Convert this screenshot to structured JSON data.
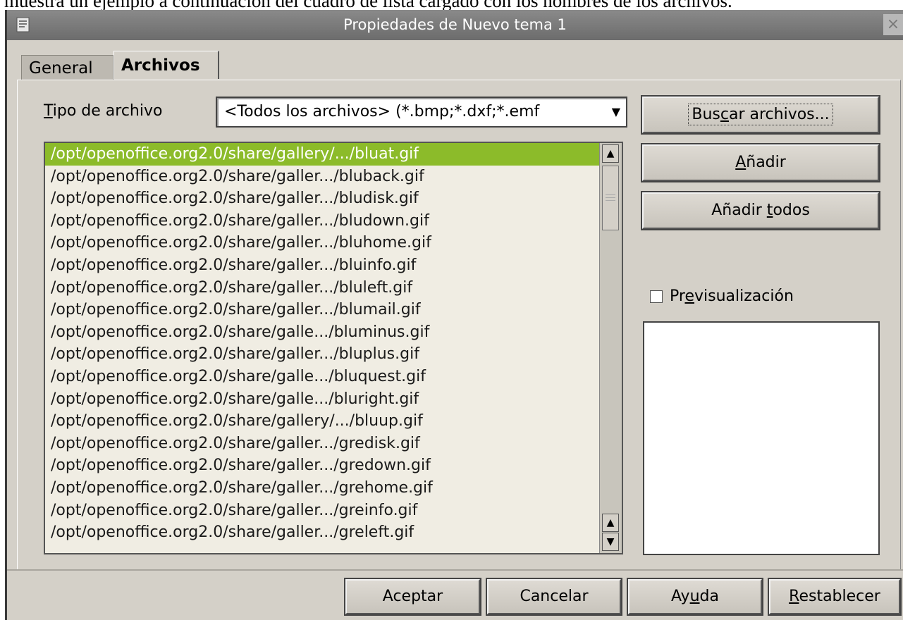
{
  "document": {
    "text": "muestra un ejemplo a continuación del cuadro de lista cargado con los nombres de los archivos."
  },
  "window": {
    "title": "Propiedades de Nuevo tema 1",
    "close_glyph": "×"
  },
  "tabs": [
    {
      "label": "General",
      "active": false
    },
    {
      "label": "Archivos",
      "active": true
    }
  ],
  "file_type": {
    "label_prefix": "T",
    "label_rest": "ipo de archivo",
    "selected": "<Todos los archivos> (*.bmp;*.dxf;*.emf"
  },
  "file_list": {
    "selected_index": 0,
    "items": [
      "/opt/openoffice.org2.0/share/gallery/.../bluat.gif",
      "/opt/openoffice.org2.0/share/galler.../bluback.gif",
      "/opt/openoffice.org2.0/share/galler.../bludisk.gif",
      "/opt/openoffice.org2.0/share/galler.../bludown.gif",
      "/opt/openoffice.org2.0/share/galler.../bluhome.gif",
      "/opt/openoffice.org2.0/share/galler.../bluinfo.gif",
      "/opt/openoffice.org2.0/share/galler.../bluleft.gif",
      "/opt/openoffice.org2.0/share/galler.../blumail.gif",
      "/opt/openoffice.org2.0/share/galle.../bluminus.gif",
      "/opt/openoffice.org2.0/share/galler.../bluplus.gif",
      "/opt/openoffice.org2.0/share/galle.../bluquest.gif",
      "/opt/openoffice.org2.0/share/galle.../bluright.gif",
      "/opt/openoffice.org2.0/share/gallery/.../bluup.gif",
      "/opt/openoffice.org2.0/share/galler.../gredisk.gif",
      "/opt/openoffice.org2.0/share/galler.../gredown.gif",
      "/opt/openoffice.org2.0/share/galler.../grehome.gif",
      "/opt/openoffice.org2.0/share/galler.../greinfo.gif",
      "/opt/openoffice.org2.0/share/galler.../greleft.gif"
    ]
  },
  "buttons": {
    "search": {
      "pre": "Bus",
      "key": "c",
      "post": "ar archivos..."
    },
    "add": {
      "pre": "",
      "key": "A",
      "post": "ñadir"
    },
    "add_all": {
      "pre": "Añadir ",
      "key": "t",
      "post": "odos"
    }
  },
  "preview": {
    "pre": "Pr",
    "key": "e",
    "post": "visualización",
    "checked": false
  },
  "footer": {
    "accept": "Aceptar",
    "cancel": "Cancelar",
    "help": {
      "pre": "Ay",
      "key": "u",
      "post": "da"
    },
    "reset": {
      "pre": "",
      "key": "R",
      "post": "establecer"
    }
  },
  "icons": {
    "app": "app-icon",
    "close": "close-icon",
    "dropdown": "chevron-down-icon",
    "scroll_up": "scroll-up-icon",
    "scroll_down": "scroll-down-icon"
  }
}
